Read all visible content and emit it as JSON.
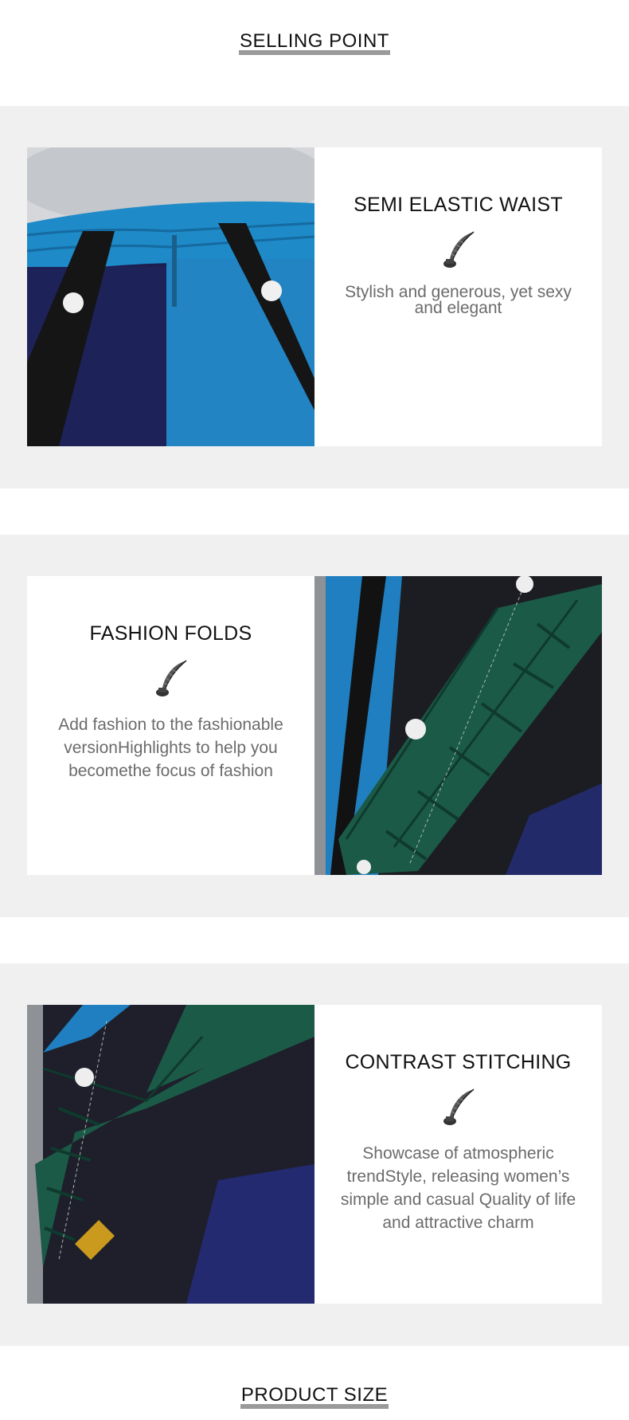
{
  "selling_point": "SELLING POINT",
  "product_size": "PRODUCT SIZE",
  "features": [
    {
      "title": "SEMI ELASTIC WAIST",
      "description": "Stylish and generous, yet sexy and elegant",
      "icon": "quill-ink-icon"
    },
    {
      "title": "FASHION FOLDS",
      "description": "Add fashion to the fashionable versionHighlights to help you becomethe focus of fashion",
      "icon": "quill-ink-icon"
    },
    {
      "title": "CONTRAST STITCHING",
      "description": "Showcase of atmospheric trendStyle, releasing women’s simple and casual Quality of life and attractive charm",
      "icon": "quill-ink-icon"
    }
  ],
  "colors": {
    "band": "#f0f0f0",
    "underline": "#9a9a9a",
    "body_text": "#6b6b6b"
  }
}
